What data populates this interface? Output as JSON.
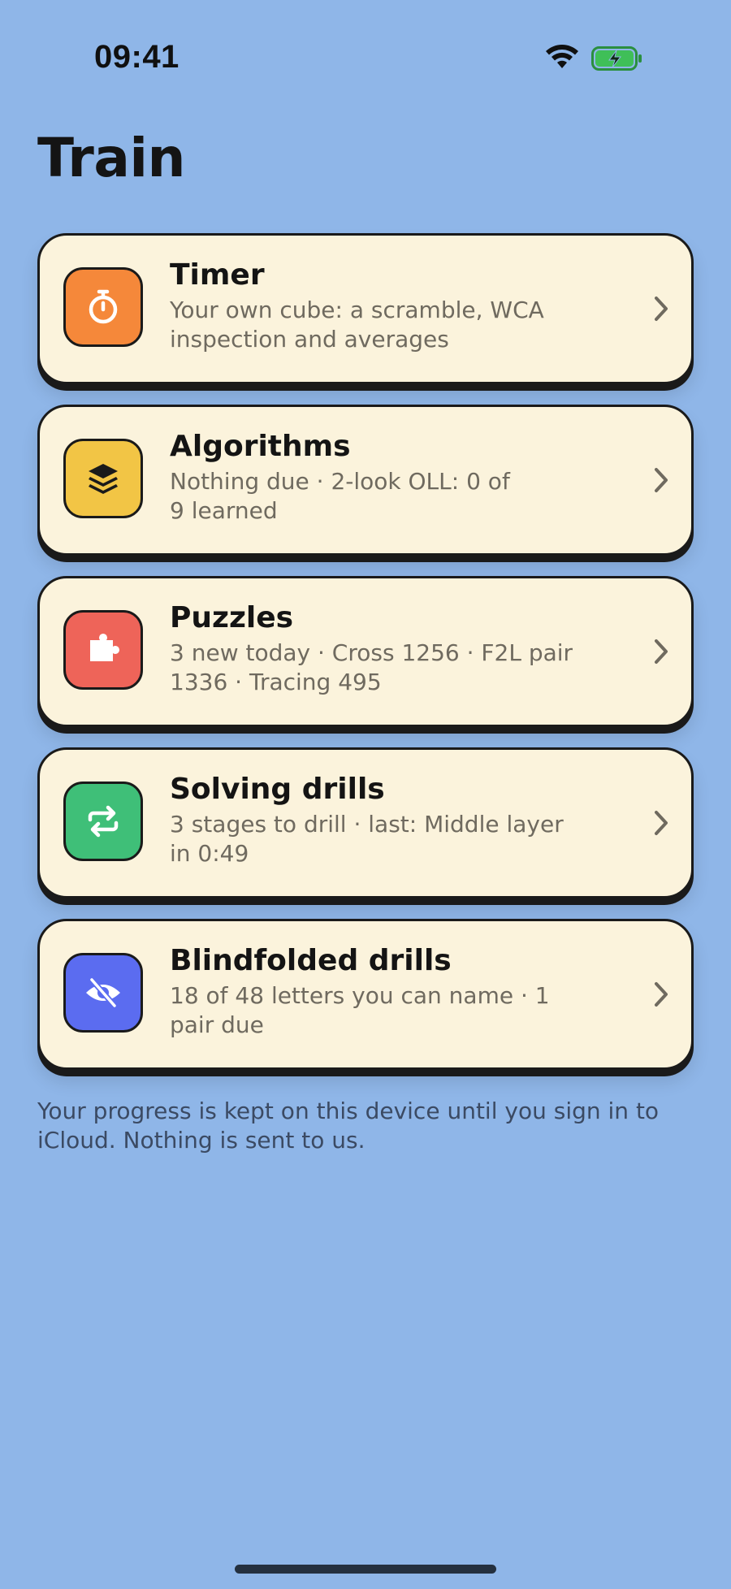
{
  "status_bar": {
    "time": "09:41"
  },
  "header": {
    "title": "Train"
  },
  "cards": [
    {
      "title": "Timer",
      "subtitle_line1": "Your own cube: a scramble, WCA",
      "subtitle_line2": "inspection and averages",
      "icon": "stopwatch-icon",
      "color": "#f5883a"
    },
    {
      "title": "Algorithms",
      "subtitle_line1": "Nothing due · 2-look OLL: 0 of",
      "subtitle_line2": "9 learned",
      "icon": "layers-icon",
      "color": "#f2c545"
    },
    {
      "title": "Puzzles",
      "subtitle_line1": "3 new today · Cross 1256 · F2L pair",
      "subtitle_line2": "1336 · Tracing 495",
      "icon": "puzzle-piece-icon",
      "color": "#ee6459"
    },
    {
      "title": "Solving drills",
      "subtitle_line1": "3 stages to drill · last: Middle layer",
      "subtitle_line2": "in 0:49",
      "icon": "repeat-arrows-icon",
      "color": "#3fbf78"
    },
    {
      "title": "Blindfolded drills",
      "subtitle_line1": "18 of 48 letters you can name · 1",
      "subtitle_line2": "pair due",
      "icon": "eye-slash-icon",
      "color": "#5b6cf0"
    }
  ],
  "footer": {
    "line1": "Your progress is kept on this device until you sign in to",
    "line2": "iCloud. Nothing is sent to us."
  }
}
